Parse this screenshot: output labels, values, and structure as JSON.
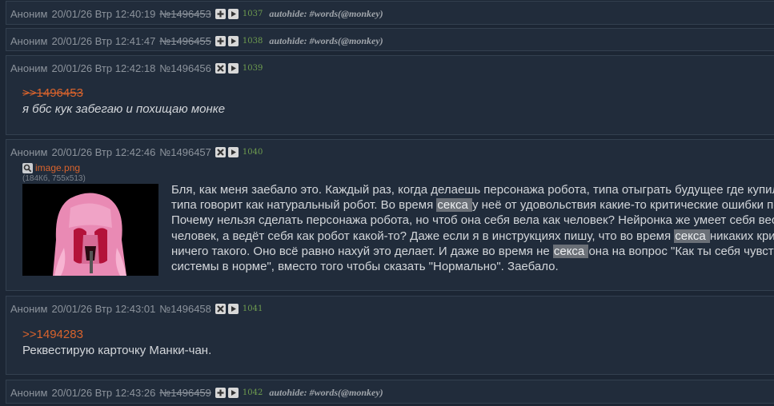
{
  "posts": [
    {
      "author": "Аноним",
      "datetime": "20/01/26 Втр 12:40:19",
      "num": "№1496453",
      "count": "1037",
      "autohide": "autohide: #words(@monkey)"
    },
    {
      "author": "Аноним",
      "datetime": "20/01/26 Втр 12:41:47",
      "num": "№1496455",
      "count": "1038",
      "autohide": "autohide: #words(@monkey)"
    },
    {
      "author": "Аноним",
      "datetime": "20/01/26 Втр 12:42:18",
      "num": "№1496456",
      "count": "1039",
      "reply": ">>1496453",
      "text": "я ббс кук забегаю и похищаю монке"
    },
    {
      "author": "Аноним",
      "datetime": "20/01/26 Втр 12:42:46",
      "num": "№1496457",
      "count": "1040",
      "file": {
        "name": "image.png",
        "info": "(184Кб, 755x513)"
      },
      "lines": [
        {
          "a": "Бля, как меня заебало это. Каждый раз, когда делаешь персонажа робота, типа отыграть будущее где купил"
        },
        {
          "a": "типа говорит как натуральный робот. Во время ",
          "h": "секса ",
          "b": "у неё от удовольствия какие-то критические ошибки по"
        },
        {
          "a": "Почему нельзя сделать персонажа робота, но чтоб она себя вела как человек? Нейронка же умеет себя вес"
        },
        {
          "a": "человек, а ведёт себя как робот какой-то? Даже если я в инструкциях пишу, что во время ",
          "h": "секса ",
          "b": "никаких кри"
        },
        {
          "a": "ничего такого. Оно всё равно нахуй это делает. И даже во время не ",
          "h": "секса ",
          "b": "она на вопрос \"Как ты себя чувств"
        },
        {
          "a": "системы в норме\", вместо того чтобы сказать \"Нормально\". Заебало."
        }
      ]
    },
    {
      "author": "Аноним",
      "datetime": "20/01/26 Втр 12:43:01",
      "num": "№1496458",
      "count": "1041",
      "reply": ">>1494283",
      "text": "Реквестирую карточку Манки-чан."
    },
    {
      "author": "Аноним",
      "datetime": "20/01/26 Втр 12:43:26",
      "num": "№1496459",
      "count": "1042",
      "autohide": "autohide: #words(@monkey)"
    }
  ]
}
